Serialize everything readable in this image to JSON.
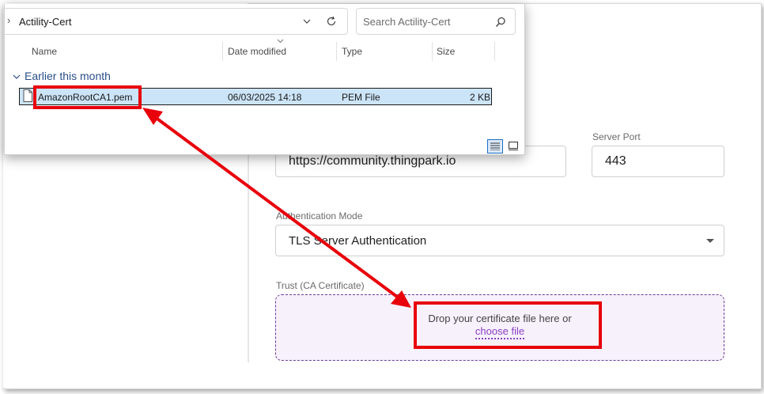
{
  "form": {
    "server_url_value": "https://community.thingpark.io",
    "server_port_label": "Server Port",
    "server_port_value": "443",
    "auth_mode_label": "Authentication Mode",
    "auth_mode_value": "TLS Server Authentication",
    "trust_label": "Trust (CA Certificate)",
    "dropzone_text": "Drop your certificate file here or",
    "dropzone_link": "choose file"
  },
  "explorer": {
    "breadcrumb_chevron": "›",
    "folder_name": "Actility-Cert",
    "search_placeholder": "Search Actility-Cert",
    "columns": [
      "Name",
      "Date modified",
      "Type",
      "Size"
    ],
    "group_label": "Earlier this month",
    "file": {
      "name": "AmazonRootCA1.pem",
      "date_modified": "06/03/2025 14:18",
      "type": "PEM File",
      "size": "2 KB"
    }
  },
  "colors": {
    "annotation_red": "#e8000b",
    "selection_blue": "#cce4f7",
    "link_purple": "#8a3fc4",
    "dropzone_border": "#6a3d9a"
  },
  "icons": [
    "chevron-right-icon",
    "chevron-down-icon",
    "refresh-icon",
    "search-icon",
    "file-icon",
    "details-view-icon",
    "tiles-view-icon",
    "select-arrow-icon",
    "double-arrow-annotation"
  ]
}
